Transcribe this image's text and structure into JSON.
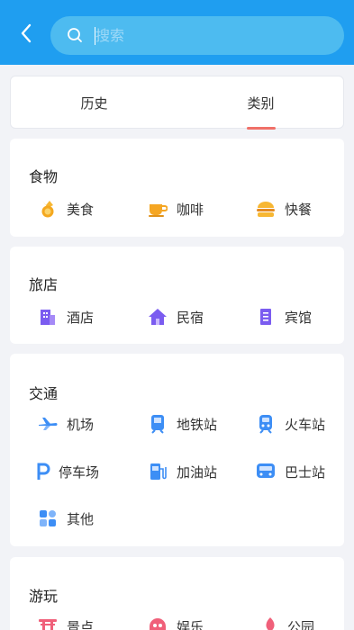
{
  "search": {
    "placeholder": "搜索"
  },
  "tabs": [
    {
      "label": "历史"
    },
    {
      "label": "类别"
    }
  ],
  "sections": [
    {
      "title": "食物",
      "items": [
        {
          "label": "美食",
          "icon": "food-icon"
        },
        {
          "label": "咖啡",
          "icon": "coffee-icon"
        },
        {
          "label": "快餐",
          "icon": "burger-icon"
        }
      ]
    },
    {
      "title": "旅店",
      "items": [
        {
          "label": "酒店",
          "icon": "hotel-building-icon"
        },
        {
          "label": "民宿",
          "icon": "house-icon"
        },
        {
          "label": "宾馆",
          "icon": "guesthouse-icon"
        }
      ]
    },
    {
      "title": "交通",
      "items": [
        {
          "label": "机场",
          "icon": "airplane-icon"
        },
        {
          "label": "地铁站",
          "icon": "subway-icon"
        },
        {
          "label": "火车站",
          "icon": "train-icon"
        },
        {
          "label": "停车场",
          "icon": "parking-icon"
        },
        {
          "label": "加油站",
          "icon": "gas-station-icon"
        },
        {
          "label": "巴士站",
          "icon": "bus-icon"
        },
        {
          "label": "其他",
          "icon": "grid-icon"
        }
      ]
    },
    {
      "title": "游玩",
      "items": [
        {
          "label": "景点",
          "icon": "torii-gate-icon"
        },
        {
          "label": "娱乐",
          "icon": "ghost-icon"
        },
        {
          "label": "公园",
          "icon": "tree-icon"
        }
      ]
    }
  ],
  "colors": {
    "topbar": "#1f9ef0",
    "search_box": "#4dbbf0",
    "tab_indicator": "#f07068"
  }
}
